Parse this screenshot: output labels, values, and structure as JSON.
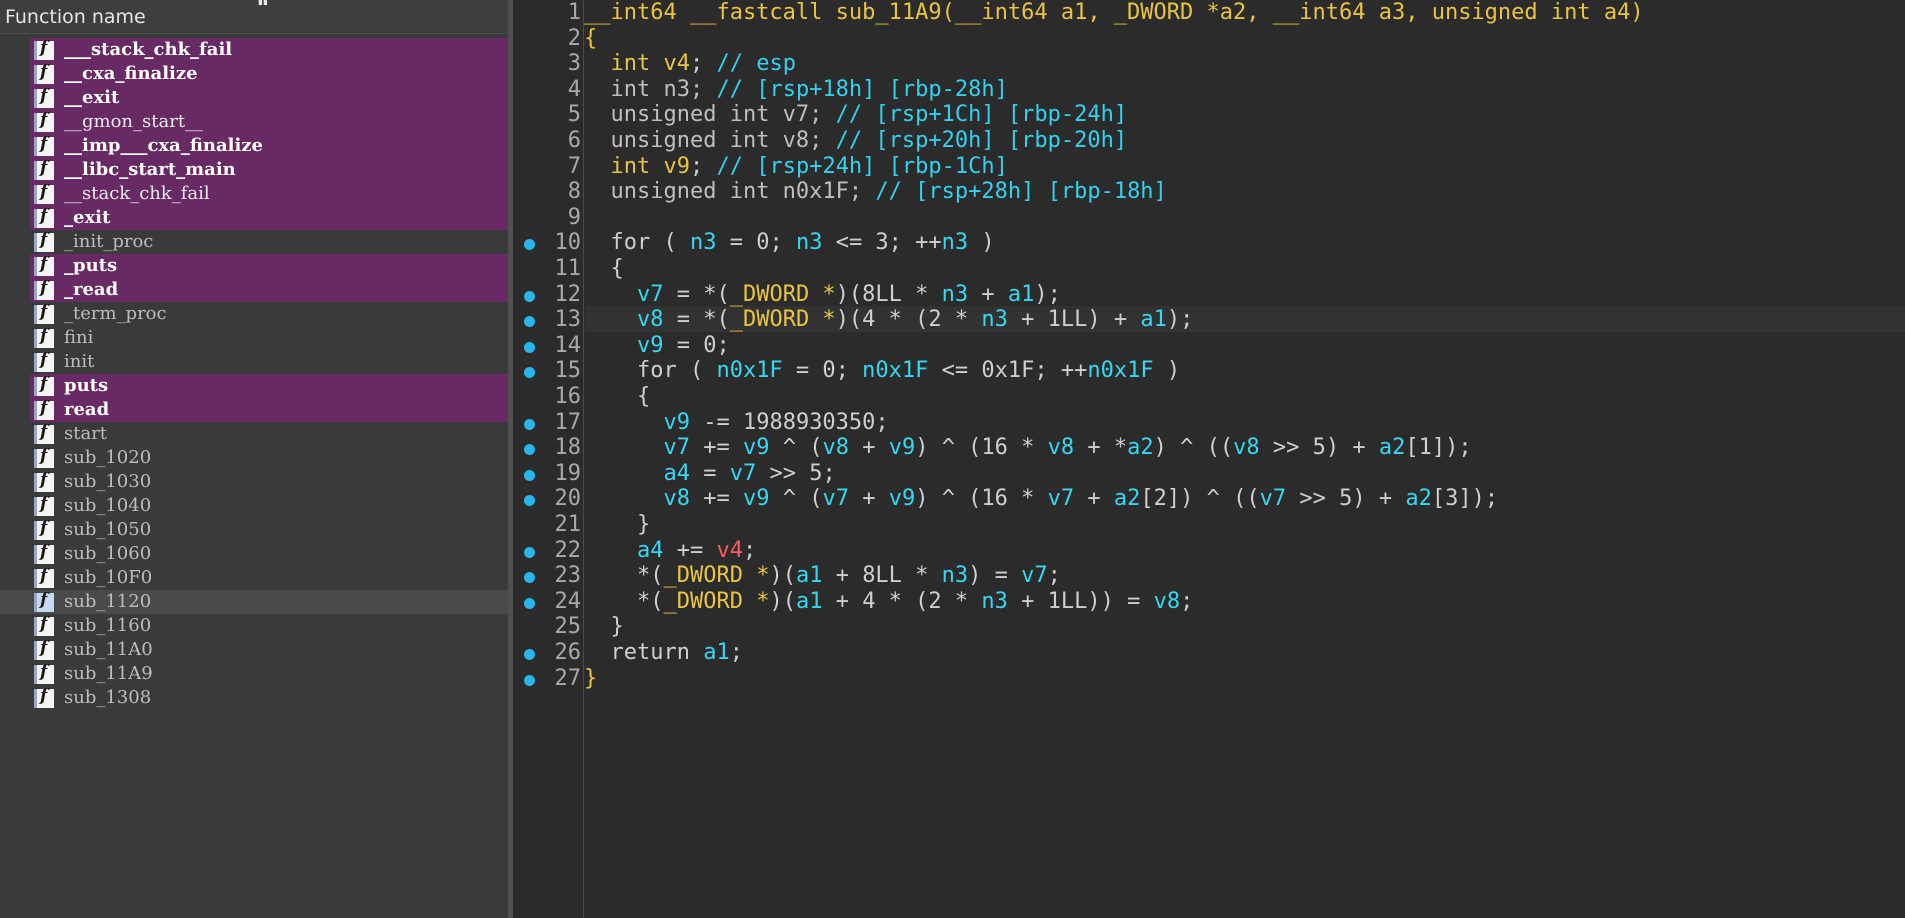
{
  "functions_panel": {
    "header_title": "Function name",
    "icon_glyph": "f",
    "items": [
      {
        "name": "___stack_chk_fail",
        "style": "highlight"
      },
      {
        "name": "__cxa_finalize",
        "style": "highlight"
      },
      {
        "name": "__exit",
        "style": "highlight"
      },
      {
        "name": "__gmon_start__",
        "style": "highlight-normal"
      },
      {
        "name": "__imp___cxa_finalize",
        "style": "highlight"
      },
      {
        "name": "__libc_start_main",
        "style": "highlight"
      },
      {
        "name": "__stack_chk_fail",
        "style": "highlight-normal"
      },
      {
        "name": "_exit",
        "style": "highlight"
      },
      {
        "name": "_init_proc",
        "style": "plain"
      },
      {
        "name": "_puts",
        "style": "highlight"
      },
      {
        "name": "_read",
        "style": "highlight"
      },
      {
        "name": "_term_proc",
        "style": "plain"
      },
      {
        "name": "fini",
        "style": "plain"
      },
      {
        "name": "init",
        "style": "plain"
      },
      {
        "name": "puts",
        "style": "highlight"
      },
      {
        "name": "read",
        "style": "highlight"
      },
      {
        "name": "start",
        "style": "plain"
      },
      {
        "name": "sub_1020",
        "style": "plain"
      },
      {
        "name": "sub_1030",
        "style": "plain"
      },
      {
        "name": "sub_1040",
        "style": "plain"
      },
      {
        "name": "sub_1050",
        "style": "plain"
      },
      {
        "name": "sub_1060",
        "style": "plain"
      },
      {
        "name": "sub_10F0",
        "style": "plain"
      },
      {
        "name": "sub_1120",
        "style": "selected"
      },
      {
        "name": "sub_1160",
        "style": "plain"
      },
      {
        "name": "sub_11A0",
        "style": "plain"
      },
      {
        "name": "sub_11A9",
        "style": "plain"
      },
      {
        "name": "sub_1308",
        "style": "plain"
      }
    ]
  },
  "pseudocode": {
    "current_line": 13,
    "lines": [
      {
        "num": "1",
        "bp": false,
        "tokens": [
          [
            "k",
            "__int64 __fastcall sub_11A9("
          ],
          [
            "k",
            "__int64 a1, _DWORD *a2, __int64 a3, unsigned int a4"
          ],
          [
            "k",
            ")"
          ]
        ]
      },
      {
        "num": "2",
        "bp": false,
        "tokens": [
          [
            "k",
            "{"
          ]
        ]
      },
      {
        "num": "3",
        "bp": false,
        "tokens": [
          [
            "p",
            "  "
          ],
          [
            "k",
            "int v4"
          ],
          [
            "p",
            "; "
          ],
          [
            "c",
            "// esp"
          ]
        ]
      },
      {
        "num": "4",
        "bp": false,
        "tokens": [
          [
            "p",
            "  "
          ],
          [
            "n",
            "int n3; "
          ],
          [
            "c",
            "// [rsp+18h] [rbp-28h]"
          ]
        ]
      },
      {
        "num": "5",
        "bp": false,
        "tokens": [
          [
            "p",
            "  "
          ],
          [
            "n",
            "unsigned int v7; "
          ],
          [
            "c",
            "// [rsp+1Ch] [rbp-24h]"
          ]
        ]
      },
      {
        "num": "6",
        "bp": false,
        "tokens": [
          [
            "p",
            "  "
          ],
          [
            "n",
            "unsigned int v8; "
          ],
          [
            "c",
            "// [rsp+20h] [rbp-20h]"
          ]
        ]
      },
      {
        "num": "7",
        "bp": false,
        "tokens": [
          [
            "p",
            "  "
          ],
          [
            "k",
            "int v9"
          ],
          [
            "p",
            "; "
          ],
          [
            "c",
            "// [rsp+24h] [rbp-1Ch]"
          ]
        ]
      },
      {
        "num": "8",
        "bp": false,
        "tokens": [
          [
            "p",
            "  "
          ],
          [
            "n",
            "unsigned int n0x1F; "
          ],
          [
            "c",
            "// [rsp+28h] [rbp-18h]"
          ]
        ]
      },
      {
        "num": "9",
        "bp": false,
        "tokens": []
      },
      {
        "num": "10",
        "bp": true,
        "tokens": [
          [
            "p",
            "  for ( "
          ],
          [
            "v",
            "n3"
          ],
          [
            "p",
            " = 0; "
          ],
          [
            "v",
            "n3"
          ],
          [
            "p",
            " <= 3; ++"
          ],
          [
            "v",
            "n3"
          ],
          [
            "p",
            " )"
          ]
        ]
      },
      {
        "num": "11",
        "bp": false,
        "tokens": [
          [
            "p",
            "  {"
          ]
        ]
      },
      {
        "num": "12",
        "bp": true,
        "tokens": [
          [
            "p",
            "    "
          ],
          [
            "v",
            "v7"
          ],
          [
            "p",
            " = *("
          ],
          [
            "f",
            "_DWORD *"
          ],
          [
            "p",
            ")(8LL * "
          ],
          [
            "v",
            "n3"
          ],
          [
            "p",
            " + "
          ],
          [
            "v",
            "a1"
          ],
          [
            "p",
            ");"
          ]
        ]
      },
      {
        "num": "13",
        "bp": true,
        "tokens": [
          [
            "p",
            "    "
          ],
          [
            "v",
            "v8"
          ],
          [
            "p",
            " = *("
          ],
          [
            "f",
            "_DWORD *"
          ],
          [
            "p",
            ")(4 * (2 * "
          ],
          [
            "v",
            "n3"
          ],
          [
            "p",
            " + 1LL) + "
          ],
          [
            "v",
            "a1"
          ],
          [
            "p",
            ");"
          ]
        ]
      },
      {
        "num": "14",
        "bp": true,
        "tokens": [
          [
            "p",
            "    "
          ],
          [
            "v",
            "v9"
          ],
          [
            "p",
            " = 0;"
          ]
        ]
      },
      {
        "num": "15",
        "bp": true,
        "tokens": [
          [
            "p",
            "    for ( "
          ],
          [
            "v",
            "n0x1F"
          ],
          [
            "p",
            " = 0; "
          ],
          [
            "v",
            "n0x1F"
          ],
          [
            "p",
            " <= 0x1F; ++"
          ],
          [
            "v",
            "n0x1F"
          ],
          [
            "p",
            " )"
          ]
        ]
      },
      {
        "num": "16",
        "bp": false,
        "tokens": [
          [
            "p",
            "    {"
          ]
        ]
      },
      {
        "num": "17",
        "bp": true,
        "tokens": [
          [
            "p",
            "      "
          ],
          [
            "v",
            "v9"
          ],
          [
            "p",
            " -= 1988930350;"
          ]
        ]
      },
      {
        "num": "18",
        "bp": true,
        "tokens": [
          [
            "p",
            "      "
          ],
          [
            "v",
            "v7"
          ],
          [
            "p",
            " += "
          ],
          [
            "v",
            "v9"
          ],
          [
            "p",
            " ^ ("
          ],
          [
            "v",
            "v8"
          ],
          [
            "p",
            " + "
          ],
          [
            "v",
            "v9"
          ],
          [
            "p",
            ") ^ (16 * "
          ],
          [
            "v",
            "v8"
          ],
          [
            "p",
            " + *"
          ],
          [
            "v",
            "a2"
          ],
          [
            "p",
            ") ^ (("
          ],
          [
            "v",
            "v8"
          ],
          [
            "p",
            " >> 5) + "
          ],
          [
            "v",
            "a2"
          ],
          [
            "p",
            "[1]);"
          ]
        ]
      },
      {
        "num": "19",
        "bp": true,
        "tokens": [
          [
            "p",
            "      "
          ],
          [
            "v",
            "a4"
          ],
          [
            "p",
            " = "
          ],
          [
            "v",
            "v7"
          ],
          [
            "p",
            " >> 5;"
          ]
        ]
      },
      {
        "num": "20",
        "bp": true,
        "tokens": [
          [
            "p",
            "      "
          ],
          [
            "v",
            "v8"
          ],
          [
            "p",
            " += "
          ],
          [
            "v",
            "v9"
          ],
          [
            "p",
            " ^ ("
          ],
          [
            "v",
            "v7"
          ],
          [
            "p",
            " + "
          ],
          [
            "v",
            "v9"
          ],
          [
            "p",
            ") ^ (16 * "
          ],
          [
            "v",
            "v7"
          ],
          [
            "p",
            " + "
          ],
          [
            "v",
            "a2"
          ],
          [
            "p",
            "[2]) ^ (("
          ],
          [
            "v",
            "v7"
          ],
          [
            "p",
            " >> 5) + "
          ],
          [
            "v",
            "a2"
          ],
          [
            "p",
            "[3]);"
          ]
        ]
      },
      {
        "num": "21",
        "bp": false,
        "tokens": [
          [
            "p",
            "    }"
          ]
        ]
      },
      {
        "num": "22",
        "bp": true,
        "tokens": [
          [
            "p",
            "    "
          ],
          [
            "v",
            "a4"
          ],
          [
            "p",
            " += "
          ],
          [
            "r",
            "v4"
          ],
          [
            "p",
            ";"
          ]
        ]
      },
      {
        "num": "23",
        "bp": true,
        "tokens": [
          [
            "p",
            "    *("
          ],
          [
            "f",
            "_DWORD *"
          ],
          [
            "p",
            ")("
          ],
          [
            "v",
            "a1"
          ],
          [
            "p",
            " + 8LL * "
          ],
          [
            "v",
            "n3"
          ],
          [
            "p",
            ") = "
          ],
          [
            "v",
            "v7"
          ],
          [
            "p",
            ";"
          ]
        ]
      },
      {
        "num": "24",
        "bp": true,
        "tokens": [
          [
            "p",
            "    *("
          ],
          [
            "f",
            "_DWORD *"
          ],
          [
            "p",
            ")("
          ],
          [
            "v",
            "a1"
          ],
          [
            "p",
            " + 4 * (2 * "
          ],
          [
            "v",
            "n3"
          ],
          [
            "p",
            " + 1LL)) = "
          ],
          [
            "v",
            "v8"
          ],
          [
            "p",
            ";"
          ]
        ]
      },
      {
        "num": "25",
        "bp": false,
        "tokens": [
          [
            "p",
            "  }"
          ]
        ]
      },
      {
        "num": "26",
        "bp": true,
        "tokens": [
          [
            "p",
            "  return "
          ],
          [
            "v",
            "a1"
          ],
          [
            "p",
            ";"
          ]
        ]
      },
      {
        "num": "27",
        "bp": true,
        "tokens": [
          [
            "k",
            "}"
          ]
        ]
      }
    ]
  },
  "colors": {
    "highlight_row": "#672a64",
    "breakpoint": "#29b6e8",
    "keyword": "#e9c442",
    "identifier": "#36d7f2",
    "register_var": "#ff5b5b"
  }
}
